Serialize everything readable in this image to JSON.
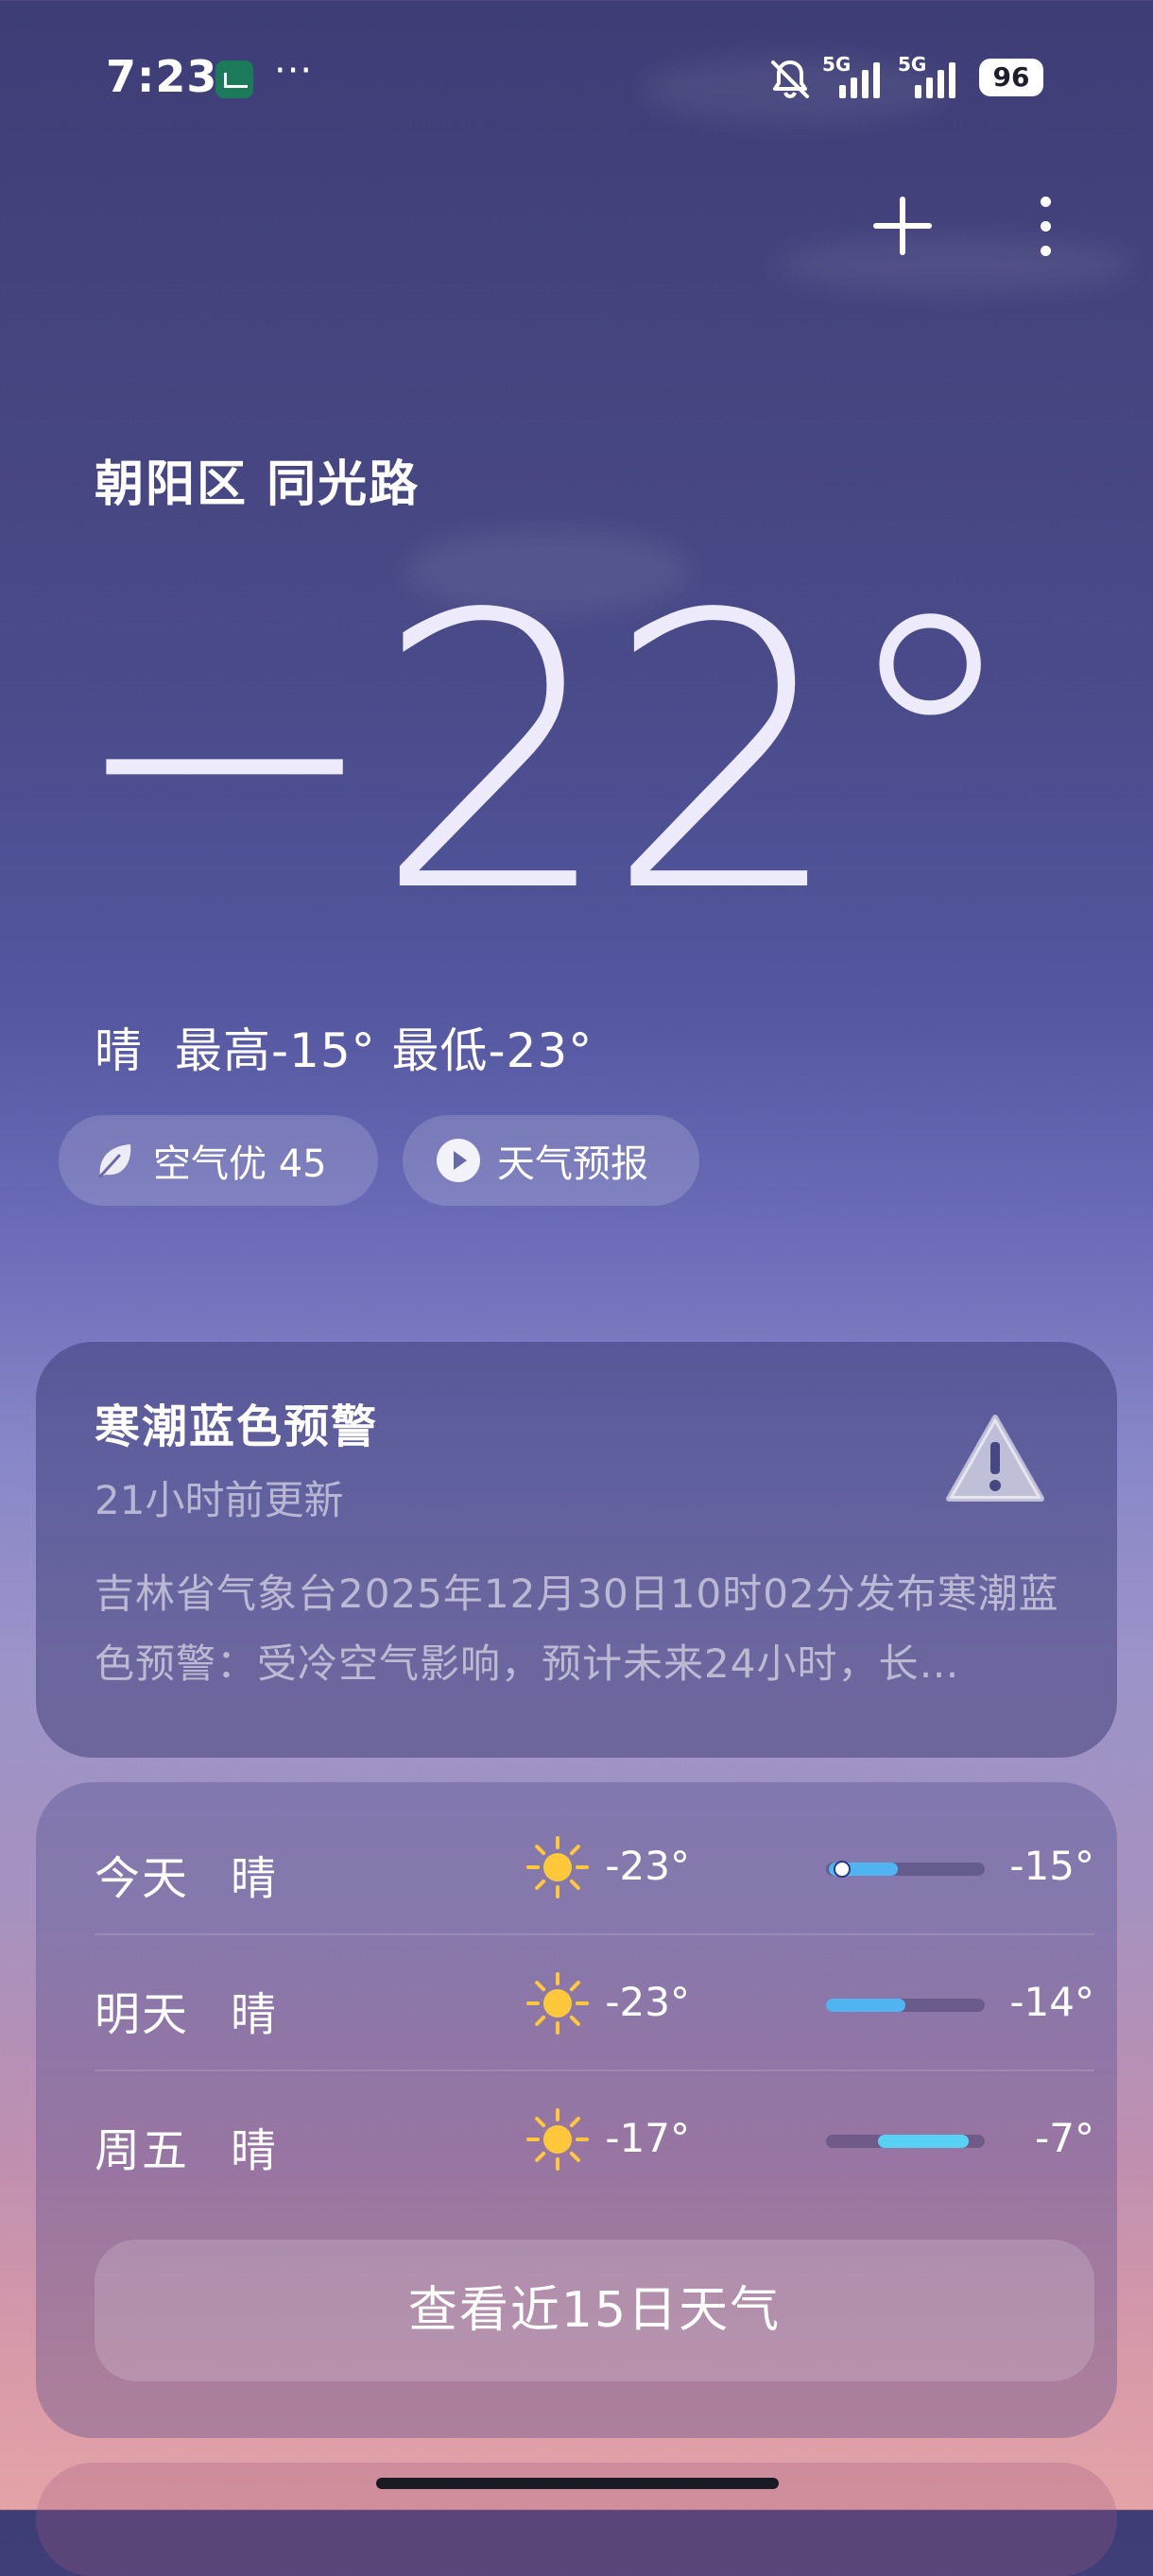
{
  "status_bar": {
    "time": "7:23",
    "more": "···",
    "sim1_network": "5G",
    "sim2_network": "5G",
    "battery": "96"
  },
  "location": "朝阳区 同光路",
  "current": {
    "temperature": "−22°",
    "condition": "晴",
    "high_low": "最高-15° 最低-23°"
  },
  "chips": {
    "air_quality": "空气优 45",
    "forecast_video": "天气预报"
  },
  "alert": {
    "title": "寒潮蓝色预警",
    "updated": "21小时前更新",
    "body": "吉林省气象台2025年12月30日10时02分发布寒潮蓝色预警：受冷空气影响，预计未来24小时，长…"
  },
  "forecast": {
    "days": [
      {
        "day": "今天",
        "condition": "晴",
        "icon": "sun-icon",
        "low": "-23°",
        "high": "-15°",
        "range_start": 0.02,
        "range_end": 0.45,
        "now": 0.1
      },
      {
        "day": "明天",
        "condition": "晴",
        "icon": "sun-icon",
        "low": "-23°",
        "high": "-14°",
        "range_start": 0.0,
        "range_end": 0.5,
        "now": null
      },
      {
        "day": "周五",
        "condition": "晴",
        "icon": "sun-icon",
        "low": "-17°",
        "high": "-7°",
        "range_start": 0.33,
        "range_end": 0.9,
        "now": null
      }
    ],
    "view_more_label": "查看近15日天气"
  },
  "colors": {
    "bar_today_tomorrow": "#4fb4f0",
    "bar_friday": "#57d2f5",
    "sun": "#ffc83a"
  }
}
